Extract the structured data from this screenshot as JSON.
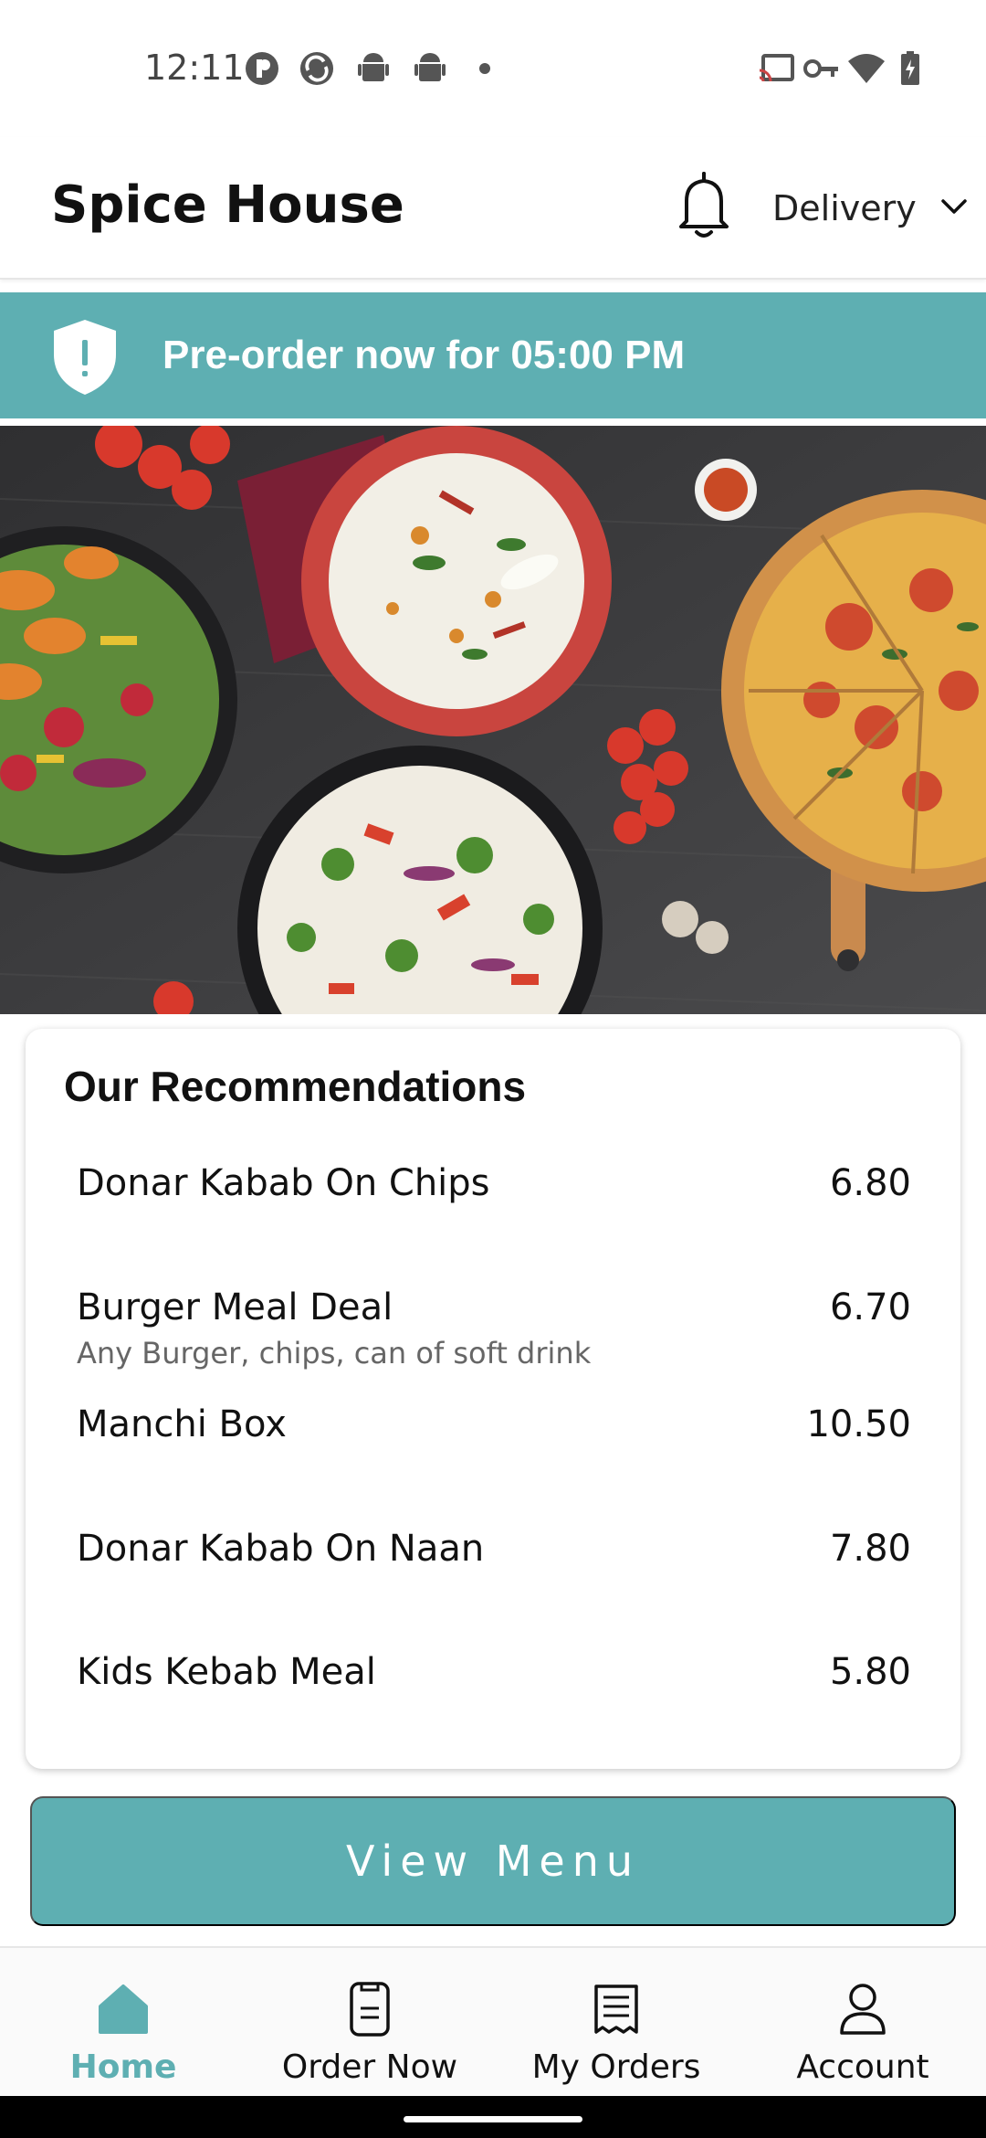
{
  "status_bar": {
    "time": "12:11"
  },
  "header": {
    "title": "Spice House",
    "notification_icon": "bell-icon",
    "mode_label": "Delivery",
    "mode_icon": "chevron-down-icon"
  },
  "banner": {
    "icon": "shield-alert-icon",
    "text": "Pre-order now for 05:00 PM"
  },
  "recommendations": {
    "title": "Our Recommendations",
    "items": [
      {
        "name": "Donar Kabab On Chips",
        "price": "6.80",
        "description": ""
      },
      {
        "name": "Burger Meal Deal",
        "price": "6.70",
        "description": "Any Burger, chips, can of soft drink"
      },
      {
        "name": "Manchi Box",
        "price": "10.50",
        "description": ""
      },
      {
        "name": "Donar Kabab On Naan",
        "price": "7.80",
        "description": ""
      },
      {
        "name": "Kids Kebab Meal",
        "price": "5.80",
        "description": ""
      }
    ]
  },
  "view_menu_label": "View Menu",
  "bottom_nav": {
    "items": [
      {
        "label": "Home",
        "icon": "home-icon",
        "active": true
      },
      {
        "label": "Order Now",
        "icon": "order-now-icon",
        "active": false
      },
      {
        "label": "My Orders",
        "icon": "receipt-icon",
        "active": false
      },
      {
        "label": "Account",
        "icon": "account-icon",
        "active": false
      }
    ]
  },
  "colors": {
    "accent": "#5eafb2",
    "hero_background": "#3a3a3c"
  }
}
